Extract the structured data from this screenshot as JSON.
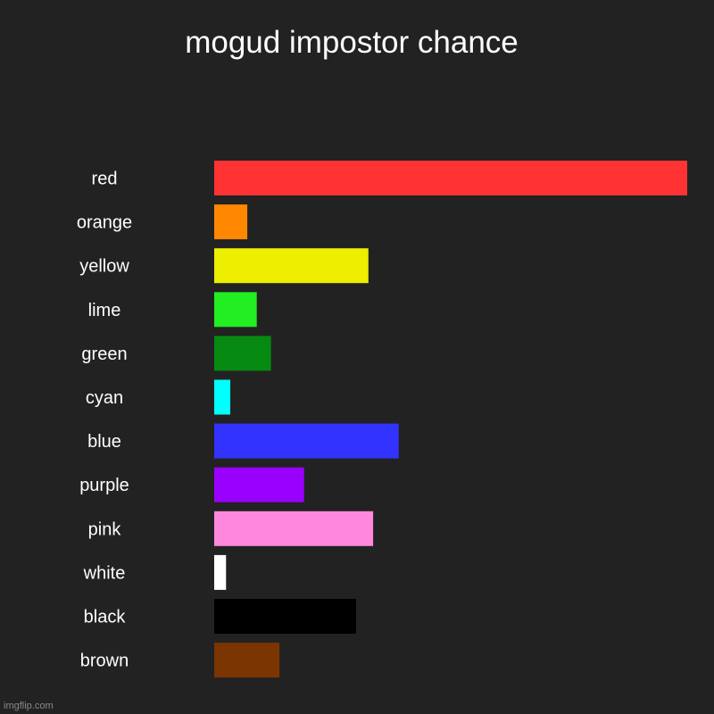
{
  "chart_data": {
    "type": "bar",
    "orientation": "horizontal",
    "title": "mogud impostor chance",
    "xlabel": "",
    "ylabel": "",
    "grid": false,
    "legend": "none",
    "categories": [
      "red",
      "orange",
      "yellow",
      "lime",
      "green",
      "cyan",
      "blue",
      "purple",
      "pink",
      "white",
      "black",
      "brown"
    ],
    "values": [
      100,
      7,
      32.6,
      9,
      12,
      3.4,
      39,
      19,
      33.6,
      2.5,
      30,
      13.8
    ],
    "colors": [
      "#ff3333",
      "#ff8800",
      "#eeee00",
      "#22ee22",
      "#078a12",
      "#00ffff",
      "#3333ff",
      "#9900ff",
      "#ff88dd",
      "#ffffff",
      "#000000",
      "#7a3500"
    ],
    "xlim": [
      0,
      100
    ]
  },
  "watermark": "imgflip.com"
}
